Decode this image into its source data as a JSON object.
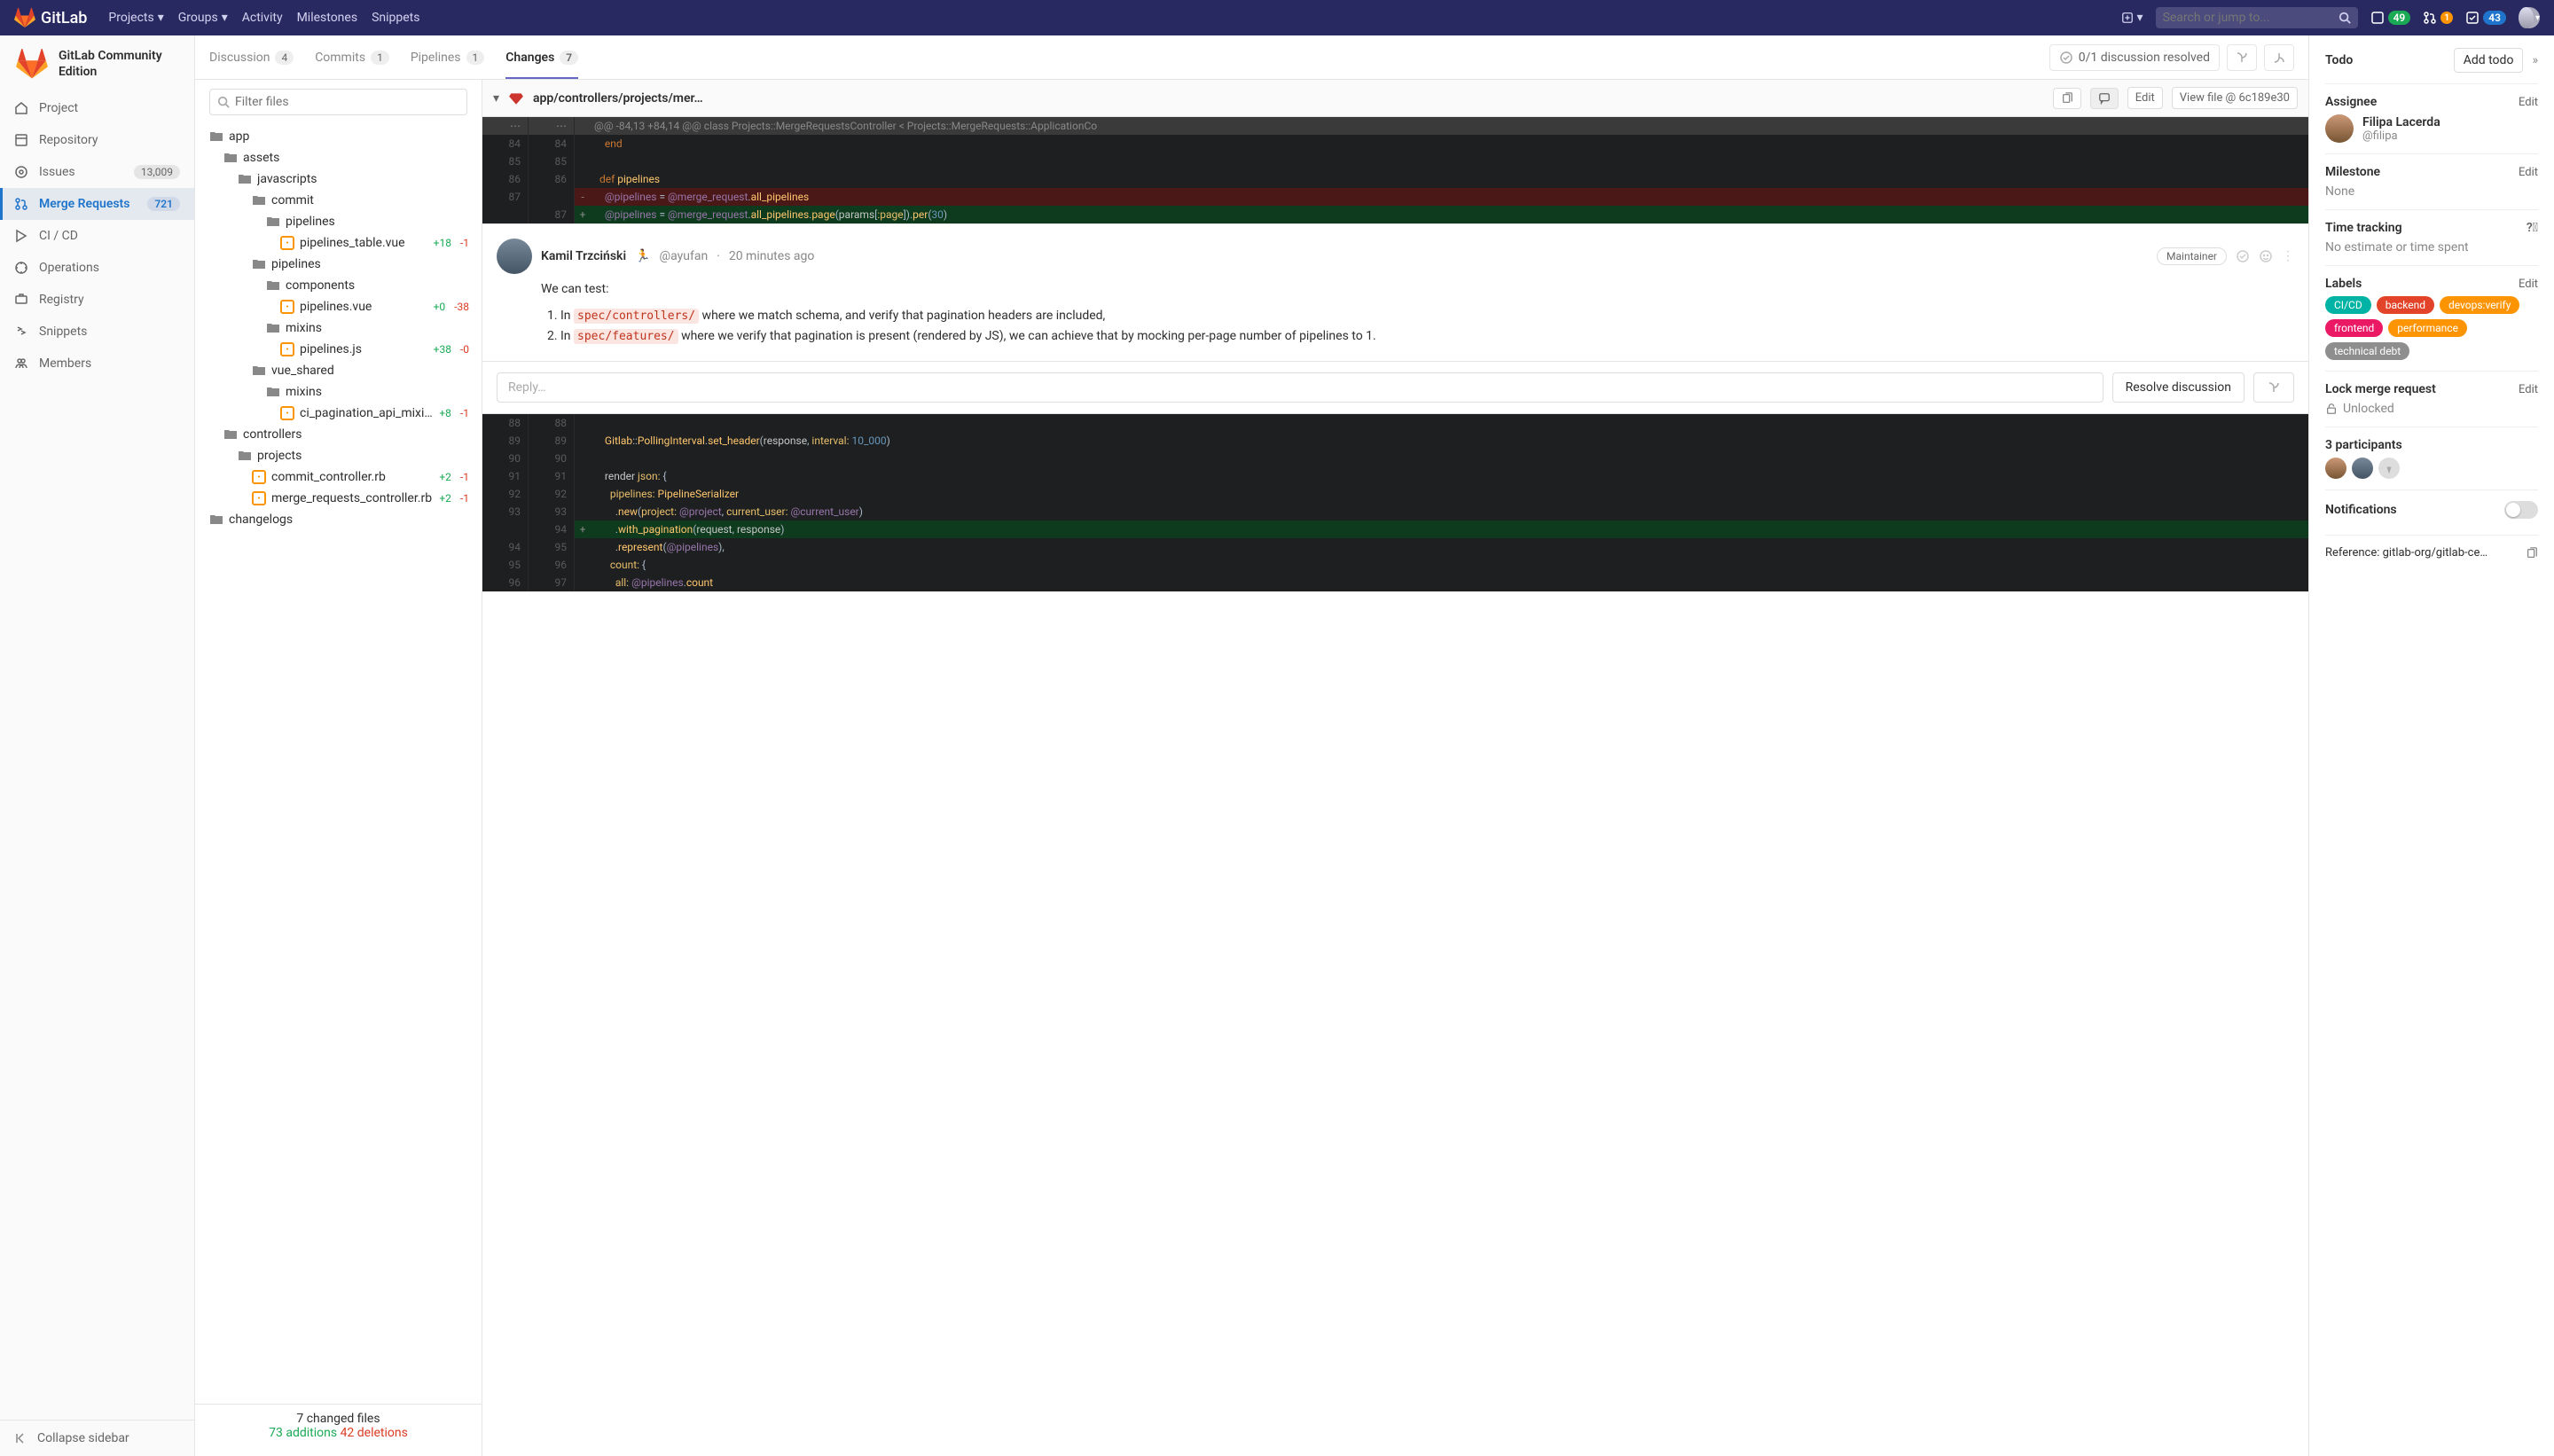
{
  "topbar": {
    "brand": "GitLab",
    "nav": [
      "Projects",
      "Groups",
      "Activity",
      "Milestones",
      "Snippets"
    ],
    "search_placeholder": "Search or jump to...",
    "issues_count": "49",
    "mr_notif": "1",
    "todos_count": "43"
  },
  "project": {
    "name": "GitLab Community Edition"
  },
  "sidebar": {
    "items": [
      {
        "label": "Project"
      },
      {
        "label": "Repository"
      },
      {
        "label": "Issues",
        "count": "13,009"
      },
      {
        "label": "Merge Requests",
        "count": "721",
        "active": true
      },
      {
        "label": "CI / CD"
      },
      {
        "label": "Operations"
      },
      {
        "label": "Registry"
      },
      {
        "label": "Snippets"
      },
      {
        "label": "Members"
      }
    ],
    "collapse": "Collapse sidebar"
  },
  "tabs": [
    {
      "label": "Discussion",
      "count": "4"
    },
    {
      "label": "Commits",
      "count": "1"
    },
    {
      "label": "Pipelines",
      "count": "1"
    },
    {
      "label": "Changes",
      "count": "7",
      "active": true
    }
  ],
  "discussion_status": "0/1 discussion resolved",
  "filter_placeholder": "Filter files",
  "tree": {
    "summary": {
      "files": "7 changed files",
      "adds": "73 additions",
      "dels": "42 deletions"
    }
  },
  "file_header": {
    "name": "app/controllers/projects/mer…",
    "edit": "Edit",
    "view": "View file @ 6c189e30"
  },
  "comment": {
    "author": "Kamil Trzciński",
    "handle": "@ayufan",
    "time": "20 minutes ago",
    "role": "Maintainer",
    "body_intro": "We can test:",
    "item1_pre": "In ",
    "item1_code": "spec/controllers/",
    "item1_post": " where we match schema, and verify that pagination headers are included,",
    "item2_pre": "In ",
    "item2_code": "spec/features/",
    "item2_post": " where we verify that pagination is present (rendered by JS), we can achieve that by mocking per-page number of pipelines to 1.",
    "reply_placeholder": "Reply…",
    "resolve": "Resolve discussion"
  },
  "rsb": {
    "todo": {
      "title": "Todo",
      "btn": "Add todo"
    },
    "assignee": {
      "title": "Assignee",
      "edit": "Edit",
      "name": "Filipa Lacerda",
      "handle": "@filipa"
    },
    "milestone": {
      "title": "Milestone",
      "edit": "Edit",
      "value": "None"
    },
    "time": {
      "title": "Time tracking",
      "value": "No estimate or time spent"
    },
    "labels": {
      "title": "Labels",
      "edit": "Edit",
      "items": [
        {
          "t": "CI/CD",
          "c": "#00b3a4"
        },
        {
          "t": "backend",
          "c": "#e24329"
        },
        {
          "t": "devops:verify",
          "c": "#fc9403"
        },
        {
          "t": "frontend",
          "c": "#eb1864"
        },
        {
          "t": "performance",
          "c": "#fc9403"
        },
        {
          "t": "technical debt",
          "c": "#8e8e8e"
        }
      ]
    },
    "lock": {
      "title": "Lock merge request",
      "edit": "Edit",
      "value": "Unlocked"
    },
    "participants": {
      "title": "3 participants"
    },
    "notifications": {
      "title": "Notifications"
    },
    "reference": {
      "label": "Reference:",
      "value": "gitlab-org/gitlab-ce…"
    }
  }
}
